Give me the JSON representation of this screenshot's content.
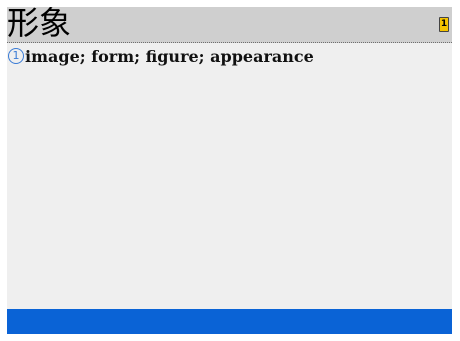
{
  "entry": {
    "headword": "形象",
    "page_badge": "1",
    "senses": [
      {
        "number": "1",
        "gloss": "image; form; figure; appearance"
      }
    ]
  },
  "colors": {
    "header_bg": "#cfcfcf",
    "panel_bg": "#efefef",
    "footer_bar": "#0a63d6",
    "badge": "#f5c400",
    "sense_marker": "#3a7bd5"
  }
}
